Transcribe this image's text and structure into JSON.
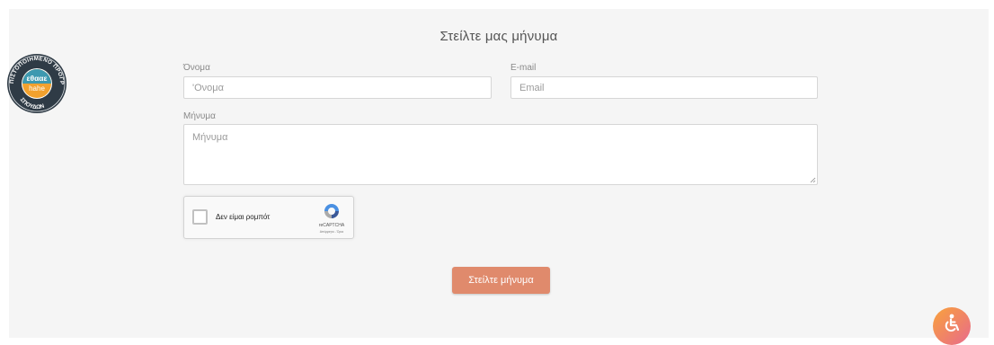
{
  "form": {
    "title": "Στείλτε μας μήνυμα",
    "name_label": "Όνομα",
    "name_placeholder": "'Ονομα",
    "email_label": "E-mail",
    "email_placeholder": "Email",
    "message_label": "Μήνυμα",
    "message_placeholder": "Μήνυμα",
    "submit_label": "Στείλτε μήνυμα"
  },
  "captcha": {
    "text": "Δεν είμαι ρομπότ",
    "brand": "reCAPTCHA",
    "links": "Απόρρητο - Όροι"
  },
  "badge": {
    "top_text": "ΠΙΣΤΟΠΟΙΗΜΕΝΟ ΠΡΟΓΡΑΜΜΑ",
    "bottom_text": "ΣΠΟΥΔΩΝ",
    "logo_greek": "εθααε",
    "logo_latin": "hahe"
  },
  "colors": {
    "submit": "#e08a6c",
    "badge_ring": "#2f3b46",
    "badge_inner": "#f2a12e",
    "badge_greek_bg": "#3d99b0"
  },
  "icons": {
    "accessibility": "wheelchair-icon",
    "captcha": "recaptcha-logo-icon"
  }
}
